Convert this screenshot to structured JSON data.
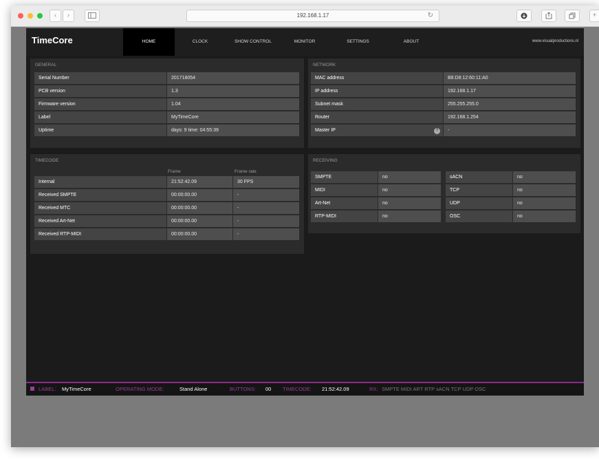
{
  "browser": {
    "url": "192.168.1.17"
  },
  "nav": {
    "brand": "TimeCore",
    "items": [
      "HOME",
      "CLOCK",
      "SHOW CONTROL",
      "MONITOR",
      "SETTINGS",
      "ABOUT"
    ],
    "active": "HOME",
    "site": "www.visualproductions.nl"
  },
  "general": {
    "title": "GENERAL",
    "rows": [
      [
        "Serial Number",
        "201718054"
      ],
      [
        "PCB version",
        "1.3"
      ],
      [
        "Firmware version",
        "1.04"
      ],
      [
        "Label",
        "MyTimeCore"
      ],
      [
        "Uptime",
        "days: 9 time: 04:55:39"
      ]
    ]
  },
  "network": {
    "title": "NETWORK",
    "rows": [
      [
        "MAC address",
        "B8:D8:12:60:11:A0"
      ],
      [
        "IP address",
        "192.168.1.17"
      ],
      [
        "Subnet mask",
        "255.255.255.0"
      ],
      [
        "Router",
        "192.168.1.254"
      ],
      [
        "Master IP",
        "-"
      ]
    ]
  },
  "timecode": {
    "title": "TIMECODE",
    "col_frame": "Frame",
    "col_rate": "Frame rate",
    "rows": [
      [
        "Internal",
        "21:52:42.09",
        "30 FPS"
      ],
      [
        "Received SMPTE",
        "00:00:00.00",
        "-"
      ],
      [
        "Received MTC",
        "00:00:00.00",
        "-"
      ],
      [
        "Received Art-Net",
        "00:00:00.00",
        "-"
      ],
      [
        "Received RTP-MIDI",
        "00:00:00.00",
        "-"
      ]
    ]
  },
  "receiving": {
    "title": "RECEIVING",
    "left": [
      [
        "SMPTE",
        "no"
      ],
      [
        "MIDI",
        "no"
      ],
      [
        "Art-Net",
        "no"
      ],
      [
        "RTP-MIDI",
        "no"
      ]
    ],
    "right": [
      [
        "sACN",
        "no"
      ],
      [
        "TCP",
        "no"
      ],
      [
        "UDP",
        "no"
      ],
      [
        "OSC",
        "no"
      ]
    ]
  },
  "status": {
    "label_key": "LABEL:",
    "label_val": "MyTimeCore",
    "mode_key": "OPERATING MODE:",
    "mode_val": "Stand Alone",
    "buttons_key": "BUTTONS:",
    "buttons_val": "00",
    "timecode_key": "TIMECODE:",
    "timecode_val": "21:52:42.09",
    "rx_key": "RX:",
    "rx_list": "SMPTE MIDI ART RTP sACN TCP UDP OSC"
  },
  "colors": {
    "accent": "#9b3a9b",
    "panel": "#2b2b2b",
    "content_bg": "#1b1b1b"
  }
}
